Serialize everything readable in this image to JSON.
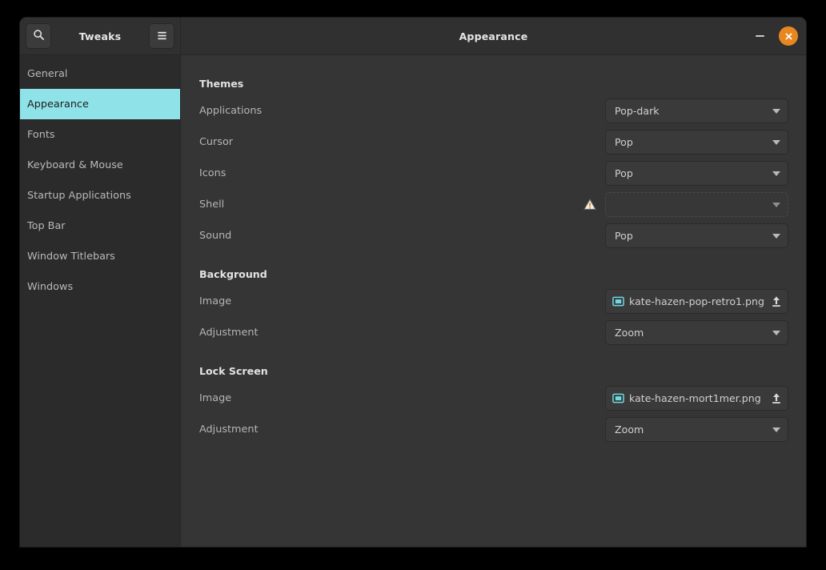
{
  "window": {
    "app_title": "Tweaks",
    "title": "Appearance",
    "search_icon": "search-icon",
    "menu_icon": "hamburger-menu-icon",
    "minimize_icon": "minimize-icon",
    "close_icon": "close-icon",
    "accent_close_color": "#e8871f",
    "selection_color": "#8fe3e8"
  },
  "sidebar": {
    "items": [
      {
        "label": "General",
        "selected": false
      },
      {
        "label": "Appearance",
        "selected": true
      },
      {
        "label": "Fonts",
        "selected": false
      },
      {
        "label": "Keyboard & Mouse",
        "selected": false
      },
      {
        "label": "Startup Applications",
        "selected": false
      },
      {
        "label": "Top Bar",
        "selected": false
      },
      {
        "label": "Window Titlebars",
        "selected": false
      },
      {
        "label": "Windows",
        "selected": false
      }
    ]
  },
  "content": {
    "sections": [
      {
        "title": "Themes",
        "rows": [
          {
            "label": "Applications",
            "control": "combo",
            "value": "Pop-dark",
            "disabled": false,
            "warning": false
          },
          {
            "label": "Cursor",
            "control": "combo",
            "value": "Pop",
            "disabled": false,
            "warning": false
          },
          {
            "label": "Icons",
            "control": "combo",
            "value": "Pop",
            "disabled": false,
            "warning": false
          },
          {
            "label": "Shell",
            "control": "combo",
            "value": "",
            "disabled": true,
            "warning": true
          },
          {
            "label": "Sound",
            "control": "combo",
            "value": "Pop",
            "disabled": false,
            "warning": false
          }
        ]
      },
      {
        "title": "Background",
        "rows": [
          {
            "label": "Image",
            "control": "file",
            "value": "kate-hazen-pop-retro1.png",
            "disabled": false,
            "warning": false
          },
          {
            "label": "Adjustment",
            "control": "combo",
            "value": "Zoom",
            "disabled": false,
            "warning": false
          }
        ]
      },
      {
        "title": "Lock Screen",
        "rows": [
          {
            "label": "Image",
            "control": "file",
            "value": "kate-hazen-mort1mer.png",
            "disabled": false,
            "warning": false
          },
          {
            "label": "Adjustment",
            "control": "combo",
            "value": "Zoom",
            "disabled": false,
            "warning": false
          }
        ]
      }
    ]
  }
}
